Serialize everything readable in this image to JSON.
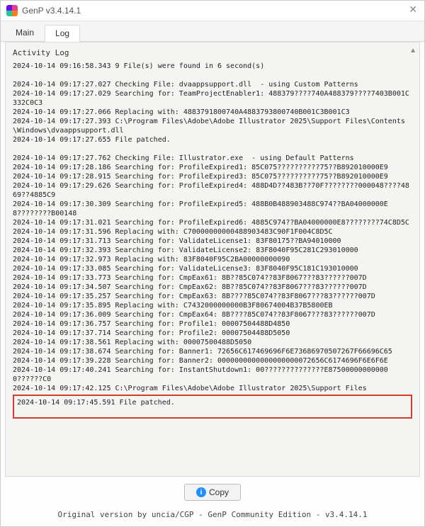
{
  "window": {
    "title": "GenP v3.4.14.1",
    "close_glyph": "✕"
  },
  "tabs": {
    "main": "Main",
    "log": "Log"
  },
  "log": {
    "heading": "Activity Log",
    "lines": [
      "2024-10-14 09:16:58.343 9 File(s) were found in 6 second(s)",
      "",
      "2024-10-14 09:17:27.027 Checking File: dvaappsupport.dll  - using Custom Patterns",
      "2024-10-14 09:17:27.029 Searching for: TeamProjectEnabler1: 488379????740A488379????7403B001C332C0C3",
      "2024-10-14 09:17:27.066 Replacing with: 4883791800740A4883793800740B001C3B001C3",
      "2024-10-14 09:17:27.393 C:\\Program Files\\Adobe\\Adobe Illustrator 2025\\Support Files\\Contents\\Windows\\dvaappsupport.dll",
      "2024-10-14 09:17:27.655 File patched.",
      "",
      "2024-10-14 09:17:27.762 Checking File: Illustrator.exe  - using Default Patterns",
      "2024-10-14 09:17:28.186 Searching for: ProfileExpired1: 85C075??????????75??B892010000E9",
      "2024-10-14 09:17:28.915 Searching for: ProfileExpired3: 85C075??????????75??B892010000E9",
      "2024-10-14 09:17:29.626 Searching for: ProfileExpired4: 488D4D??483B??70F????????000048????4869??4885C9",
      "2024-10-14 09:17:30.309 Searching for: ProfileExpired5: 488B0B488903488C974??BA04000000E8????????B00148",
      "2024-10-14 09:17:31.021 Searching for: ProfileExpired6: 4885C974??BA04000000E8????????74C8D5C",
      "2024-10-14 09:17:31.596 Replacing with: C70000000000488903483C90F1F004C8D5C",
      "2024-10-14 09:17:31.713 Searching for: ValidateLicense1: 83F80175??BA94010000",
      "2024-10-14 09:17:32.393 Searching for: ValidateLicense2: 83F8040F95C281C293010000",
      "2024-10-14 09:17:32.973 Replacing with: 83F8040F95C2BA00000000090",
      "2024-10-14 09:17:33.085 Searching for: ValidateLicense3: 83F8040F95C181C193010000",
      "2024-10-14 09:17:33.773 Searching for: CmpEax61: 8B??85C074??83F8067???83??????007D",
      "2024-10-14 09:17:34.507 Searching for: CmpEax62: 8B??85C074??83F8067???83??????007D",
      "2024-10-14 09:17:35.257 Searching for: CmpEax63: 8B????85C074??83F8067???83??????007D",
      "2024-10-14 09:17:35.895 Replacing with: C7432000000000B3F80674004B37B5800EB",
      "2024-10-14 09:17:36.009 Searching for: CmpEax64: 8B????85C074??83F8067???83??????007D",
      "2024-10-14 09:17:36.757 Searching for: Profile1: 00007504488D4850",
      "2024-10-14 09:17:37.714 Searching for: Profile2: 00007504488D5050",
      "2024-10-14 09:17:38.561 Replacing with: 00007500488D5050",
      "2024-10-14 09:17:38.674 Searching for: Banner1: 72656C617469696F6E73686970507267F66696C65",
      "2024-10-14 09:17:39.228 Searching for: Banner2: 0000000000000000000072656C6174696F6E6F6E",
      "2024-10-14 09:17:40.241 Searching for: InstantShutdown1: 00??????????????E875000000000000??????C0",
      "2024-10-14 09:17:42.125 C:\\Program Files\\Adobe\\Adobe Illustrator 2025\\Support Files"
    ],
    "highlighted": [
      "2024-10-14 09:17:45.591 File patched."
    ]
  },
  "buttons": {
    "copy": "Copy"
  },
  "footer": {
    "text": "Original version by uncia/CGP - GenP Community Edition - v3.4.14.1"
  }
}
